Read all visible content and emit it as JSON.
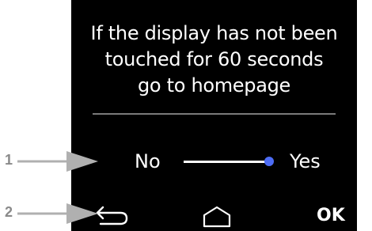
{
  "screen": {
    "message_lines": [
      "If the display has not been",
      "touched for 60 seconds",
      "go to homepage"
    ],
    "toggle": {
      "off_label": "No",
      "on_label": "Yes",
      "selected": "Yes"
    },
    "nav": {
      "back_icon": "back-arrow-icon",
      "home_icon": "home-icon",
      "ok_label": "OK"
    }
  },
  "callouts": {
    "one": "1",
    "two": "2"
  },
  "colors": {
    "screen_background": "#000000",
    "text": "#ffffff",
    "toggle_knob": "#4d6cf5",
    "divider": "#7a7a7a",
    "callout": "#8a8a8a"
  }
}
